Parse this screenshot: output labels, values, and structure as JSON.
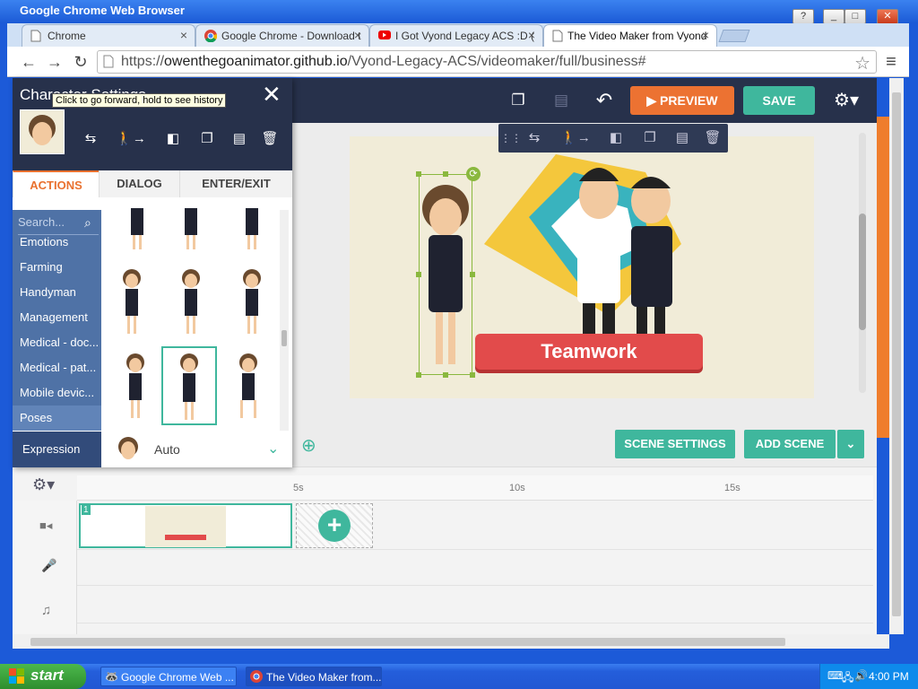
{
  "window": {
    "title": "Google Chrome Web Browser",
    "controls": {
      "help": "?",
      "minimize": "_",
      "maximize": "□",
      "close": "✕"
    }
  },
  "tabs": [
    {
      "label": "Chrome",
      "close": "×"
    },
    {
      "label": "Google Chrome - Download t",
      "close": "×"
    },
    {
      "label": "I Got Vyond Legacy ACS :D (",
      "close": "×"
    },
    {
      "label": "The Video Maker from Vyond",
      "close": "×"
    }
  ],
  "browser": {
    "url_scheme": "https://",
    "url_host": "owenthegoanimator.github.io",
    "url_path": "/Vyond-Legacy-ACS/videomaker/full/business#",
    "tooltip": "Click to go forward, hold to see history"
  },
  "app": {
    "preview_label": "PREVIEW",
    "save_label": "SAVE",
    "scene_settings_label": "SCENE SETTINGS",
    "add_scene_label": "ADD SCENE",
    "ribbon_text": "Teamwork",
    "timeline_ticks": [
      "5s",
      "10s",
      "15s"
    ],
    "scene_number": "1"
  },
  "panel": {
    "title": "Character Settings",
    "tabs": [
      "ACTIONS",
      "DIALOG",
      "ENTER/EXIT"
    ],
    "search_placeholder": "Search...",
    "categories": [
      "Emotions",
      "Farming",
      "Handyman",
      "Management",
      "Medical - doc...",
      "Medical - pat...",
      "Mobile devic...",
      "Poses"
    ],
    "expression_label": "Expression",
    "expression_value": "Auto"
  },
  "taskbar": {
    "start": "start",
    "items": [
      "Google Chrome Web ...",
      "The Video Maker from..."
    ],
    "clock": "4:00 PM"
  },
  "colors": {
    "accent_teal": "#3fb79d",
    "preview_orange": "#ec7232",
    "app_header": "#27314b",
    "category_blue": "#4f72a6"
  }
}
